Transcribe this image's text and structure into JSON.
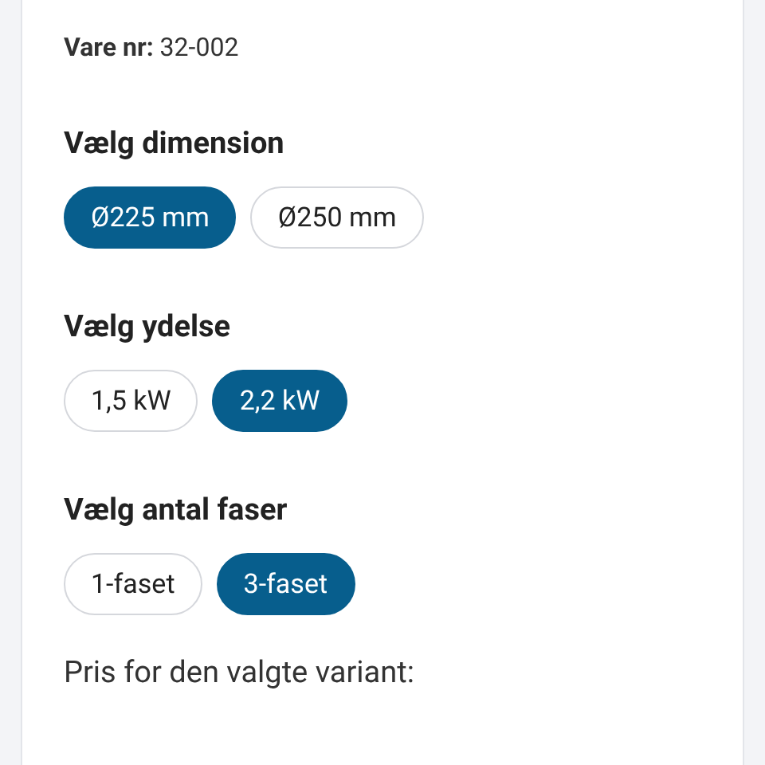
{
  "product": {
    "sku_label": "Vare nr:",
    "sku": "32-002"
  },
  "option_groups": [
    {
      "label": "Vælg dimension",
      "options": [
        {
          "label": "Ø225 mm",
          "selected": true
        },
        {
          "label": "Ø250 mm",
          "selected": false
        }
      ]
    },
    {
      "label": "Vælg ydelse",
      "options": [
        {
          "label": "1,5 kW",
          "selected": false
        },
        {
          "label": "2,2 kW",
          "selected": true
        }
      ]
    },
    {
      "label": "Vælg antal faser",
      "options": [
        {
          "label": "1-faset",
          "selected": false
        },
        {
          "label": "3-faset",
          "selected": true
        }
      ]
    }
  ],
  "price": {
    "label": "Pris for den valgte variant:"
  }
}
